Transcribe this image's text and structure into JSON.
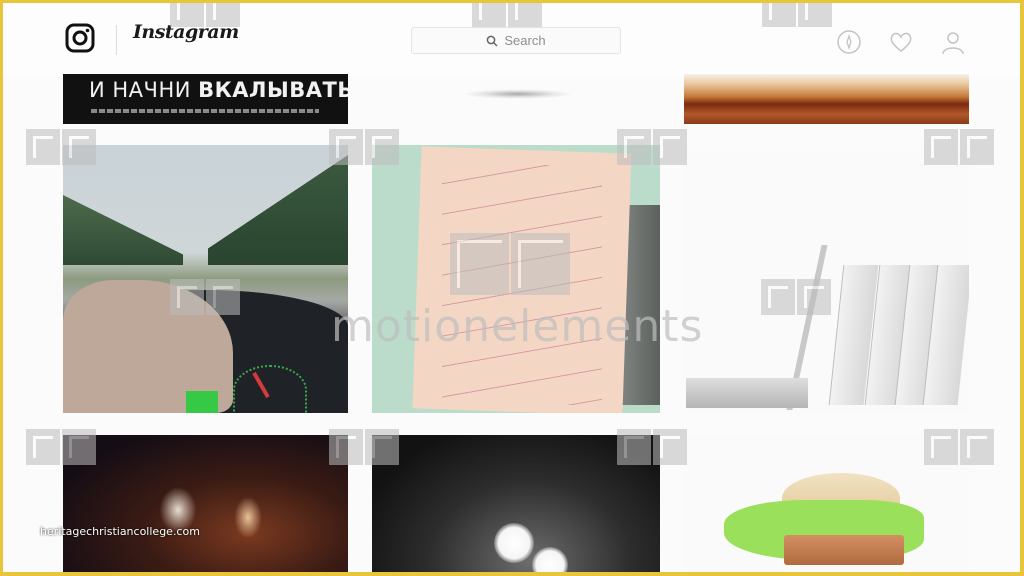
{
  "header": {
    "wordmark": "Instagram",
    "search": {
      "placeholder": "Search"
    },
    "nav": [
      {
        "name": "explore",
        "icon": "compass-icon"
      },
      {
        "name": "activity",
        "icon": "heart-icon"
      },
      {
        "name": "profile",
        "icon": "user-icon"
      }
    ]
  },
  "posts": [
    {
      "id": "post-1",
      "caption_main": "И НАЧНИ",
      "caption_bold": "ВКАЛЫВАТЬ",
      "description": "black banner with russian motivational text"
    },
    {
      "id": "post-2",
      "description": "blurred grey smudge"
    },
    {
      "id": "post-3",
      "description": "open book on wooden surface"
    },
    {
      "id": "post-4",
      "description": "driving on forest road, hand on steering wheel"
    },
    {
      "id": "post-5",
      "description": "pink sticky note with handwritten text"
    },
    {
      "id": "post-6",
      "description": "laptop leaning on white books"
    },
    {
      "id": "post-7",
      "description": "night scene with lights"
    },
    {
      "id": "post-8",
      "description": "street lamps glowing at night"
    },
    {
      "id": "post-9",
      "description": "burger made from a book"
    }
  ],
  "overlay": {
    "watermark_text": "motionelements",
    "url_text": "heritagechristiancollege.com"
  },
  "colors": {
    "frame": "#e8c53a",
    "background": "#fbfbfb",
    "search_text": "#8e8e8e"
  }
}
